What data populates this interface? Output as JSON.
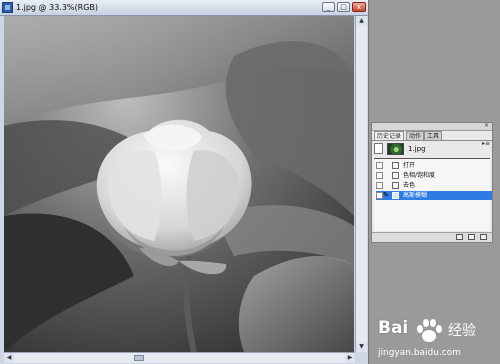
{
  "document_window": {
    "title": "1.jpg @ 33.3%(RGB)",
    "buttons": [
      "_",
      "□",
      "x"
    ]
  },
  "history_panel": {
    "tabs": [
      "历史记录",
      "动作",
      "工具"
    ],
    "menu_icon": "▸≡",
    "snapshot_label": "1.jpg",
    "steps": [
      {
        "label": "打开"
      },
      {
        "label": "色相/饱和度"
      },
      {
        "label": "去色"
      },
      {
        "label": "高斯模糊",
        "selected": true
      }
    ]
  },
  "watermark": {
    "brand": "Bai",
    "brand_suffix": "经验",
    "url": "jingyan.baidu.com"
  }
}
